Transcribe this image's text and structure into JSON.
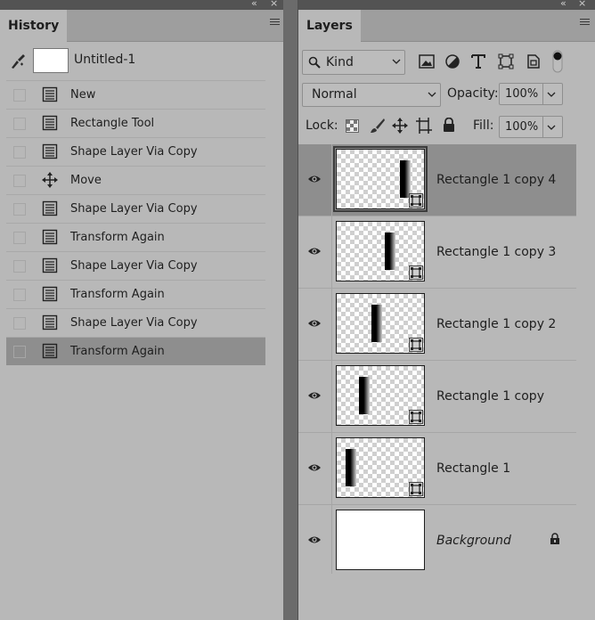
{
  "history": {
    "title": "History",
    "snapshot": "Untitled-1",
    "items": [
      {
        "label": "New",
        "icon": "document-icon"
      },
      {
        "label": "Rectangle Tool",
        "icon": "document-icon"
      },
      {
        "label": "Shape Layer Via Copy",
        "icon": "document-icon"
      },
      {
        "label": "Move",
        "icon": "move-icon"
      },
      {
        "label": "Shape Layer Via Copy",
        "icon": "document-icon"
      },
      {
        "label": "Transform Again",
        "icon": "document-icon"
      },
      {
        "label": "Shape Layer Via Copy",
        "icon": "document-icon"
      },
      {
        "label": "Transform Again",
        "icon": "document-icon"
      },
      {
        "label": "Shape Layer Via Copy",
        "icon": "document-icon"
      },
      {
        "label": "Transform Again",
        "icon": "document-icon"
      }
    ]
  },
  "layers": {
    "title": "Layers",
    "filter_kind": "Kind",
    "blend_mode": "Normal",
    "opacity_label": "Opacity:",
    "opacity_value": "100%",
    "lock_label": "Lock:",
    "fill_label": "Fill:",
    "fill_value": "100%",
    "items": [
      {
        "name": "Rectangle 1 copy 4",
        "bar_pos": 0.72
      },
      {
        "name": "Rectangle 1 copy 3",
        "bar_pos": 0.55
      },
      {
        "name": "Rectangle 1 copy 2",
        "bar_pos": 0.4
      },
      {
        "name": "Rectangle 1 copy",
        "bar_pos": 0.25
      },
      {
        "name": "Rectangle 1",
        "bar_pos": 0.1
      },
      {
        "name": "Background",
        "bar_pos": null
      }
    ]
  },
  "ui": {
    "panel_ctl": "«",
    "close_ctl": "×"
  }
}
